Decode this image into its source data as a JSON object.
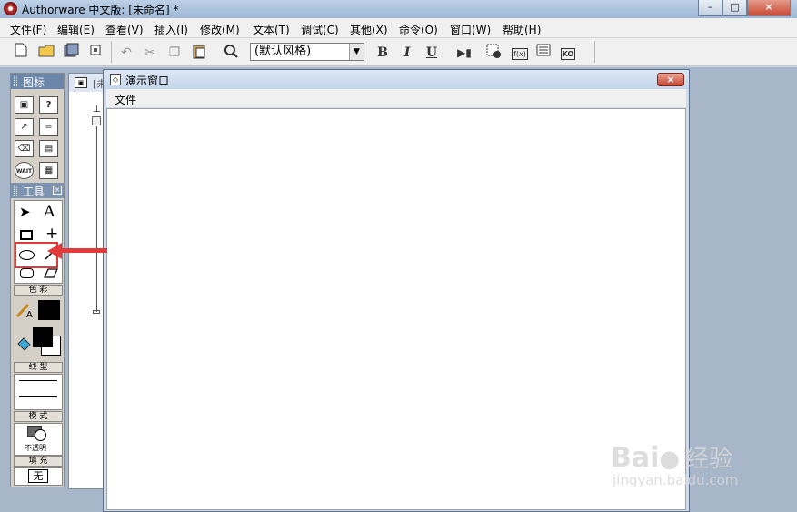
{
  "window": {
    "title": "Authorware 中文版: [未命名] *",
    "controls": [
      "–",
      "□",
      "×"
    ]
  },
  "menubar": [
    "文件(F)",
    "编辑(E)",
    "查看(V)",
    "插入(I)",
    "修改(M)",
    "文本(T)",
    "调试(C)",
    "其他(X)",
    "命令(O)",
    "窗口(W)",
    "帮助(H)"
  ],
  "toolbar": {
    "style_value": "(默认风格)",
    "bold": "B",
    "italic": "I",
    "underline": "U",
    "fx_label": "f(x)",
    "ko_label": "KO"
  },
  "icon_palette": {
    "title": "图标",
    "wait_label": "WAIT"
  },
  "tools_palette": {
    "title": "工具",
    "text_tool": "A",
    "color_section": "色 彩",
    "line_section": "线 型",
    "mode_section": "模 式",
    "mode_value": "不透明",
    "fill_section": "填 充",
    "fill_value": "无"
  },
  "flowline_window": {
    "title": "[未"
  },
  "presentation_window": {
    "title": "演示窗口",
    "menu": "文件"
  },
  "watermark": {
    "brand": "Bai",
    "brand_suffix": "经验",
    "url": "jingyan.baidu.com"
  },
  "colors": {
    "annotation": "#e23a3a",
    "palette_header": "#6a86a8"
  }
}
